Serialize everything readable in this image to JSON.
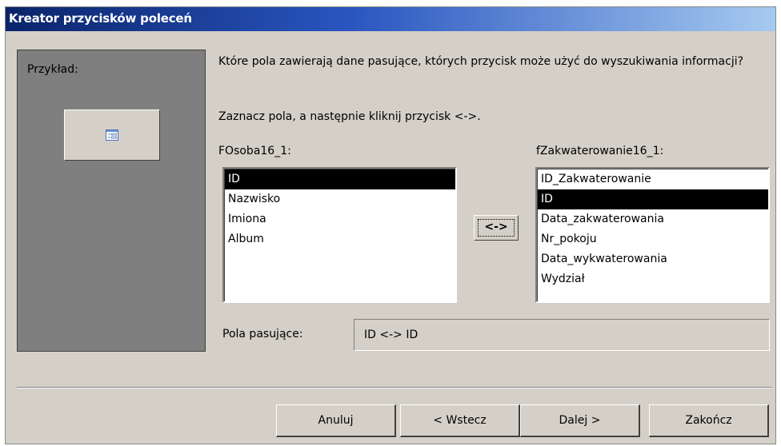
{
  "window": {
    "title": "Kreator przycisków poleceń"
  },
  "preview": {
    "label": "Przykład:",
    "button_icon": "form-icon"
  },
  "instructions": {
    "question": "Które pola zawierają  dane pasujące, których przycisk może użyć do wyszukiwania informacji?",
    "hint": "Zaznacz pola, a następnie kliknij przycisk <->."
  },
  "left_list": {
    "label": "FOsoba16_1:",
    "items": [
      "ID",
      "Nazwisko",
      "Imiona",
      "Album"
    ],
    "selected": "ID"
  },
  "right_list": {
    "label": "fZakwaterowanie16_1:",
    "items": [
      "ID_Zakwaterowanie",
      "ID",
      "Data_zakwaterowania",
      "Nr_pokoju",
      "Data_wykwaterowania",
      "Wydział"
    ],
    "selected": "ID"
  },
  "swap_button": {
    "label": "<->"
  },
  "matched": {
    "label": "Pola pasujące:",
    "value": "ID <-> ID"
  },
  "buttons": {
    "cancel": "Anuluj",
    "back": "< Wstecz",
    "next": "Dalej >",
    "finish": "Zakończ"
  },
  "colors": {
    "title_gradient_start": "#0a246a",
    "title_gradient_end": "#a6caf0",
    "dialog_face": "#d4d0c8",
    "preview_panel": "#7f7f7f",
    "selection": "#000000"
  }
}
